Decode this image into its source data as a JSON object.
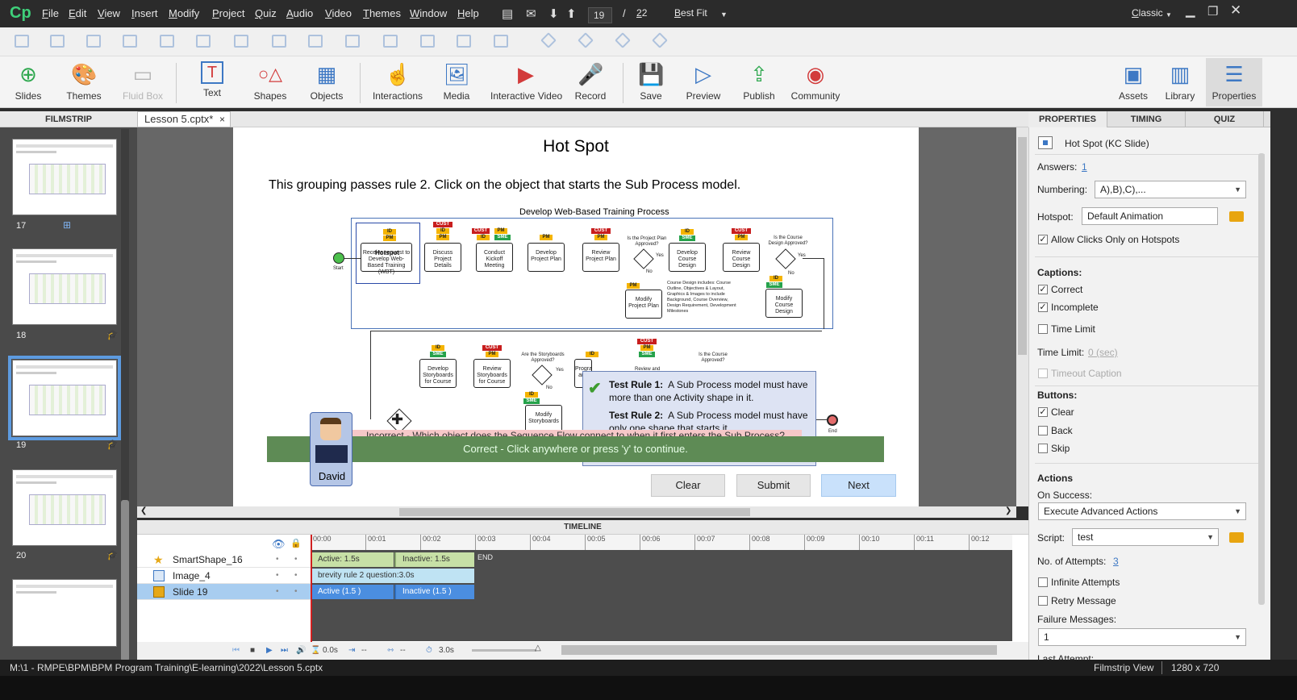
{
  "app": {
    "logo": "Cp",
    "mode": "Classic"
  },
  "menu": [
    "File",
    "Edit",
    "View",
    "Insert",
    "Modify",
    "Project",
    "Quiz",
    "Audio",
    "Video",
    "Themes",
    "Window",
    "Help"
  ],
  "slide_nav": {
    "current": "19",
    "separator": "/",
    "total": "22",
    "zoom": "Best Fit"
  },
  "toolbar": {
    "slides": "Slides",
    "themes": "Themes",
    "fluidbox": "Fluid Box",
    "text": "Text",
    "shapes": "Shapes",
    "objects": "Objects",
    "interactions": "Interactions",
    "media": "Media",
    "interactive_video": "Interactive Video",
    "record": "Record",
    "save": "Save",
    "preview": "Preview",
    "publish": "Publish",
    "community": "Community",
    "assets": "Assets",
    "library": "Library",
    "properties": "Properties"
  },
  "filmstrip": {
    "header": "FILMSTRIP",
    "thumbs": [
      {
        "num": "17"
      },
      {
        "num": "18"
      },
      {
        "num": "19"
      },
      {
        "num": "20"
      }
    ]
  },
  "doc_tab": {
    "name": "Lesson 5.cptx*",
    "close": "×"
  },
  "slide": {
    "title": "Hot Spot",
    "text": "This grouping passes rule 2.  Click on the object that starts the Sub Process model.",
    "diagram_title": "Develop Web-Based Training Process",
    "diagram": {
      "start": "Start",
      "hotspot": "Hotspot",
      "a1": "Receive request to Develop Web-Based Training (WBT)",
      "a2": "Discuss Project Details",
      "a3": "Conduct Kickoff Meeting",
      "a4": "Develop Project Plan",
      "a5": "Review Project Plan",
      "q1": "Is the Project Plan Approved?",
      "a6": "Develop Course Design",
      "a7": "Review Course Design",
      "q2": "Is the Course Design Approved?",
      "mod1": "Modify Project Plan",
      "mod2": "Modify Course Design",
      "yes": "Yes",
      "no": "No",
      "design_note": "Course Design includes: Course Outline, Objectives & Layout, Graphics & Images to include Background, Course Overview, Design Requirement, Development Milestones",
      "b1": "Develop Storyboards for Course",
      "b2": "Review Storyboards for Course",
      "q3": "Are the Storyboards Approved?",
      "b3": "Program and",
      "b4": "Review and",
      "q4": "Is the Course Approved?",
      "mod3": "Modify Storyboards",
      "end": "End"
    },
    "rule1_title": "Test Rule 1:",
    "rule1": "A Sub Process model must have more than one Activity shape in it.",
    "rule2_title": "Test Rule 2:",
    "rule2": "A Sub Process model must have only one shape that starts it.",
    "incorrect": "Incorrect - Which object does the Sequence Flow connect to when it first enters the Sub Process?",
    "correct": "Correct - Click anywhere or press 'y' to continue.",
    "character": "David",
    "btn_clear": "Clear",
    "btn_submit": "Submit",
    "btn_next": "Next"
  },
  "timeline": {
    "header": "TIMELINE",
    "ticks": [
      "00:00",
      "00:01",
      "00:02",
      "00:03",
      "00:04",
      "00:05",
      "00:06",
      "00:07",
      "00:08",
      "00:09",
      "00:10",
      "00:11",
      "00:12"
    ],
    "layers": [
      {
        "name": "SmartShape_16",
        "active": "Active: 1.5s",
        "inactive": "Inactive: 1.5s"
      },
      {
        "name": "Image_4",
        "bar": "brevity rule 2 question:3.0s"
      },
      {
        "name": "Slide 19",
        "active": "Active (1.5 )",
        "inactive": "Inactive (1.5 )"
      }
    ],
    "end": "END",
    "time1": "0.0s",
    "time2": "--",
    "time3": "--",
    "duration": "3.0s"
  },
  "properties": {
    "tabs": [
      "PROPERTIES",
      "TIMING",
      "QUIZ"
    ],
    "slide_type": "Hot Spot (KC Slide)",
    "answers_label": "Answers:",
    "answers": "1",
    "numbering_label": "Numbering:",
    "numbering": "A),B),C),...",
    "hotspot_label": "Hotspot:",
    "hotspot": "Default Animation",
    "allow_clicks": "Allow Clicks Only on Hotspots",
    "captions": "Captions:",
    "correct": "Correct",
    "incomplete": "Incomplete",
    "time_limit": "Time Limit",
    "time_limit_label": "Time Limit:",
    "time_limit_value": "0 (sec)",
    "timeout_caption": "Timeout Caption",
    "buttons": "Buttons:",
    "clear": "Clear",
    "back": "Back",
    "skip": "Skip",
    "actions": "Actions",
    "on_success": "On Success:",
    "on_success_value": "Execute Advanced Actions",
    "script_label": "Script:",
    "script": "test",
    "attempts_label": "No. of Attempts:",
    "attempts": "3",
    "infinite": "Infinite Attempts",
    "retry": "Retry Message",
    "failure_label": "Failure Messages:",
    "failure": "1",
    "last_attempt": "Last Attempt:"
  },
  "status": {
    "path": "M:\\1 - RMPE\\BPM\\BPM Program Training\\E-learning\\2022\\Lesson 5.cptx",
    "view": "Filmstrip View",
    "size": "1280 x 720"
  }
}
